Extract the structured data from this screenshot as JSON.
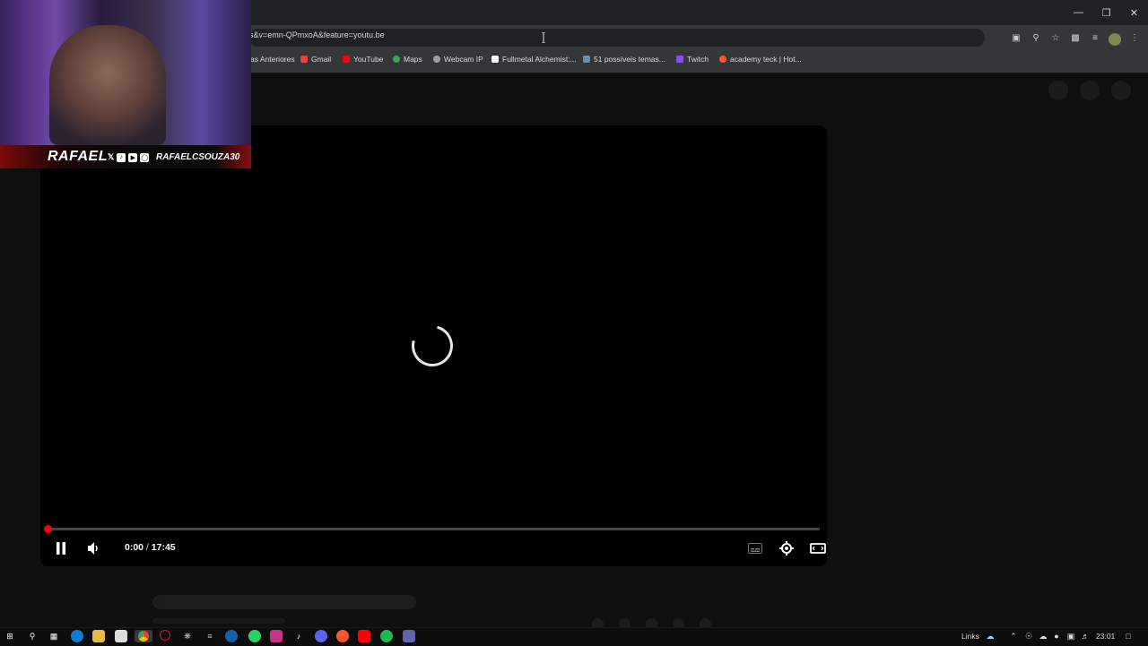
{
  "browser": {
    "url": "s&v=emn-QPmxoA&feature=youtu.be",
    "window_controls": [
      "minimize",
      "restore",
      "close"
    ],
    "toolbar_icons": [
      "install-app-icon",
      "zoom-icon",
      "star-icon",
      "extensions-icon",
      "tab-search-icon",
      "profile-avatar",
      "menu-icon"
    ]
  },
  "bookmarks": [
    {
      "label": "as Anteriores",
      "icon": "folder-icon",
      "color": "#dcdcdc"
    },
    {
      "label": "Gmail",
      "icon": "gmail-icon",
      "color": "#ea4335"
    },
    {
      "label": "YouTube",
      "icon": "youtube-icon",
      "color": "#ff0000"
    },
    {
      "label": "Maps",
      "icon": "maps-icon",
      "color": "#34a853"
    },
    {
      "label": "Webcam IP",
      "icon": "webcam-icon",
      "color": "#9aa0a6"
    },
    {
      "label": "Fullmetal Alchemist:...",
      "icon": "site-icon",
      "color": "#ffffff"
    },
    {
      "label": "51 possíveis temas...",
      "icon": "site-icon",
      "color": "#6b8fb3"
    },
    {
      "label": "Twitch",
      "icon": "twitch-icon",
      "color": "#9146ff"
    },
    {
      "label": "academy teck | Hot...",
      "icon": "fire-icon",
      "color": "#ff5722"
    }
  ],
  "webcam": {
    "name": "RAFAEL",
    "handle": "RAFAELCSOUZA30",
    "social_icons": [
      "x-icon",
      "tiktok-icon",
      "youtube-icon",
      "instagram-icon"
    ]
  },
  "player": {
    "current_time": "0:00",
    "separator": " / ",
    "duration": "17:45",
    "progress": 0,
    "state": "loading",
    "controls": [
      "pause-icon",
      "volume-icon",
      "subtitles-icon",
      "settings-icon",
      "theater-icon"
    ]
  },
  "taskbar": {
    "apps": [
      "start-icon",
      "search-icon",
      "task-view-icon",
      "edge-icon",
      "explorer-icon",
      "store-icon",
      "chrome-icon",
      "opera-icon",
      "chatgpt-icon",
      "menu-app-icon",
      "steam-icon",
      "whatsapp-icon",
      "instagram-icon",
      "tiktok-icon",
      "discord-icon",
      "brave-icon",
      "youtube-icon",
      "spotify-icon",
      "teams-icon"
    ],
    "links_label": "Links",
    "clock": "23:01"
  },
  "colors": {
    "accent_red": "#ff0000",
    "page_bg": "#0f0f0f",
    "chrome_bg": "#35363a"
  }
}
